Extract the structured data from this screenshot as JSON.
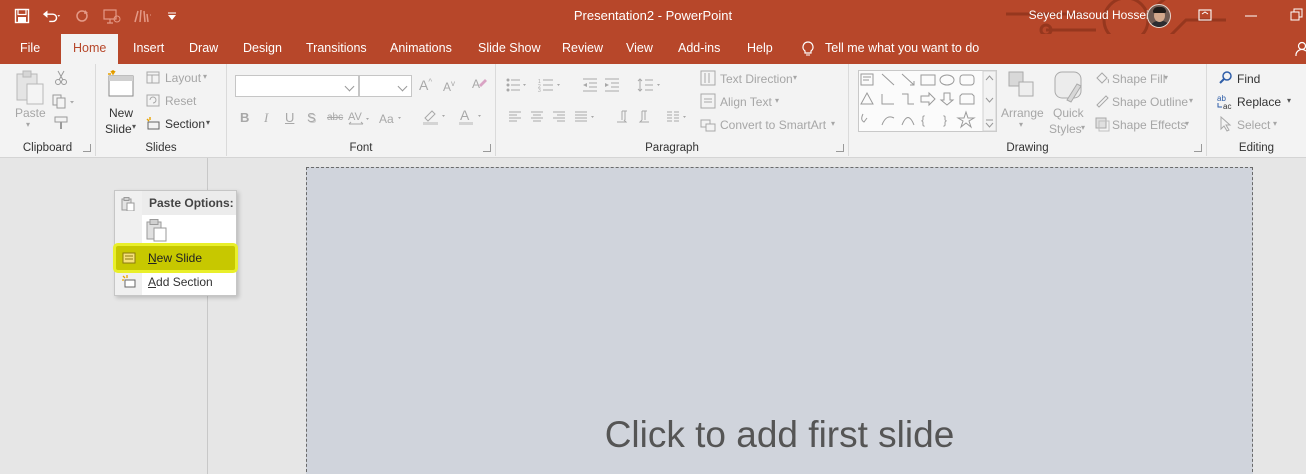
{
  "titlebar": {
    "document_title": "Presentation2  -  PowerPoint",
    "user_name": "Seyed Masoud Hosseini",
    "accent_color": "#b7472a"
  },
  "tabs": [
    {
      "label": "File"
    },
    {
      "label": "Home"
    },
    {
      "label": "Insert"
    },
    {
      "label": "Draw"
    },
    {
      "label": "Design"
    },
    {
      "label": "Transitions"
    },
    {
      "label": "Animations"
    },
    {
      "label": "Slide Show"
    },
    {
      "label": "Review"
    },
    {
      "label": "View"
    },
    {
      "label": "Add-ins"
    },
    {
      "label": "Help"
    }
  ],
  "tell_me": {
    "placeholder": "Tell me what you want to do"
  },
  "ribbon": {
    "clipboard": {
      "label": "Clipboard",
      "paste": "Paste"
    },
    "slides": {
      "label": "Slides",
      "new_slide_line1": "New",
      "new_slide_line2": "Slide",
      "layout": "Layout",
      "reset": "Reset",
      "section": "Section"
    },
    "font": {
      "label": "Font",
      "bold": "B",
      "italic": "I",
      "underline": "U",
      "shadow": "S",
      "strike": "abc",
      "grow": "A",
      "shrink": "A",
      "clear": "A",
      "color": "A"
    },
    "paragraph": {
      "label": "Paragraph",
      "text_direction": "Text Direction",
      "align_text": "Align Text",
      "convert_smartart": "Convert to SmartArt"
    },
    "drawing": {
      "label": "Drawing",
      "arrange": "Arrange",
      "quick_styles_line1": "Quick",
      "quick_styles_line2": "Styles",
      "shape_fill": "Shape Fill",
      "shape_outline": "Shape Outline",
      "shape_effects": "Shape Effects"
    },
    "editing": {
      "label": "Editing",
      "find": "Find",
      "replace": "Replace",
      "select": "Select"
    }
  },
  "context_menu": {
    "header": "Paste Options:",
    "new_slide": "New Slide",
    "new_slide_underlined_char": "N",
    "new_slide_rest": "ew Slide",
    "add_section": "Add Section",
    "add_section_underlined_char": "A",
    "add_section_rest": "dd Section",
    "highlight_color": "#c7c800"
  },
  "slide_placeholder": {
    "text": "Click to add first slide"
  }
}
